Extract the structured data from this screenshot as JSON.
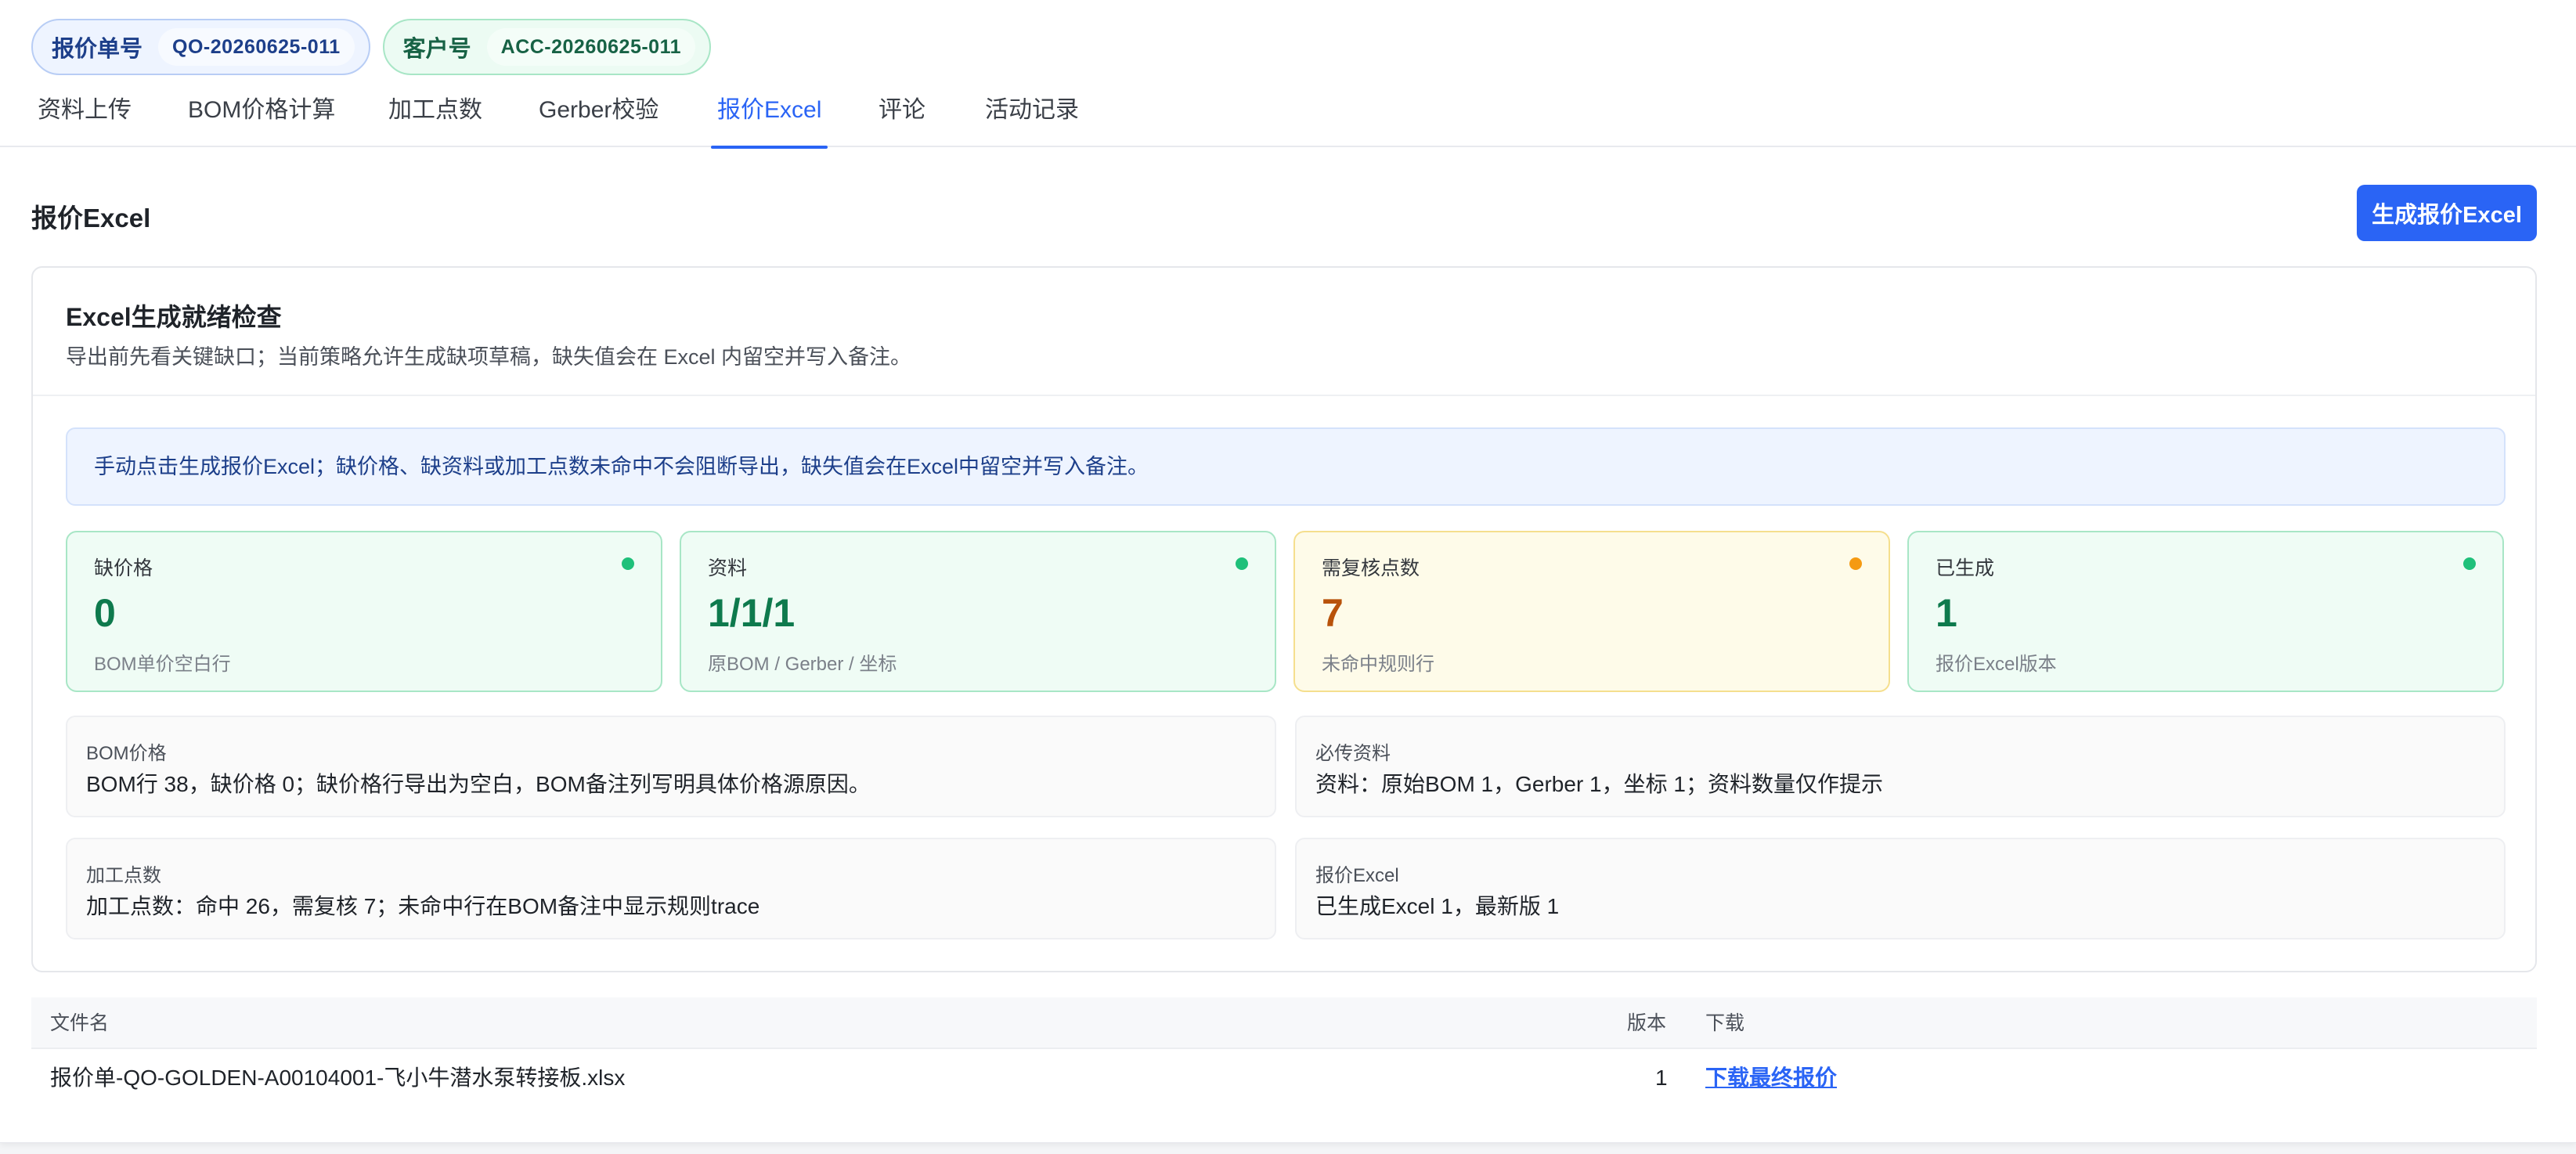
{
  "header": {
    "quote_label": "报价单号",
    "quote_value": "QO-20260625-011",
    "account_label": "客户号",
    "account_value": "ACC-20260625-011"
  },
  "tabs": [
    {
      "label": "资料上传",
      "active": false
    },
    {
      "label": "BOM价格计算",
      "active": false
    },
    {
      "label": "加工点数",
      "active": false
    },
    {
      "label": "Gerber校验",
      "active": false
    },
    {
      "label": "报价Excel",
      "active": true
    },
    {
      "label": "评论",
      "active": false
    },
    {
      "label": "活动记录",
      "active": false
    }
  ],
  "section": {
    "title": "报价Excel",
    "generate_button": "生成报价Excel"
  },
  "readiness": {
    "title": "Excel生成就绪检查",
    "subtitle": "导出前先看关键缺口；当前策略允许生成缺项草稿，缺失值会在 Excel 内留空并写入备注。",
    "notice": "手动点击生成报价Excel；缺价格、缺资料或加工点数未命中不会阻断导出，缺失值会在Excel中留空并写入备注。",
    "stats": [
      {
        "label": "缺价格",
        "value": "0",
        "desc": "BOM单价空白行",
        "status": "ok"
      },
      {
        "label": "资料",
        "value": "1/1/1",
        "desc": "原BOM / Gerber / 坐标",
        "status": "ok"
      },
      {
        "label": "需复核点数",
        "value": "7",
        "desc": "未命中规则行",
        "status": "warn"
      },
      {
        "label": "已生成",
        "value": "1",
        "desc": "报价Excel版本",
        "status": "ok"
      }
    ],
    "details": [
      {
        "label": "BOM价格",
        "text": "BOM行 38，缺价格 0；缺价格行导出为空白，BOM备注列写明具体价格源原因。"
      },
      {
        "label": "必传资料",
        "text": "资料：原始BOM 1，Gerber 1，坐标 1；资料数量仅作提示"
      },
      {
        "label": "加工点数",
        "text": "加工点数：命中 26，需复核 7；未命中行在BOM备注中显示规则trace"
      },
      {
        "label": "报价Excel",
        "text": "已生成Excel 1，最新版 1"
      }
    ]
  },
  "files_table": {
    "columns": [
      "文件名",
      "版本",
      "下载"
    ],
    "rows": [
      {
        "filename": "报价单-QO-GOLDEN-A00104001-飞小牛潜水泵转接板.xlsx",
        "version": "1",
        "download": "下载最终报价"
      }
    ]
  },
  "colors": {
    "accent": "#2a64f5",
    "ok": "#1fc07a",
    "warn": "#f59a12"
  }
}
